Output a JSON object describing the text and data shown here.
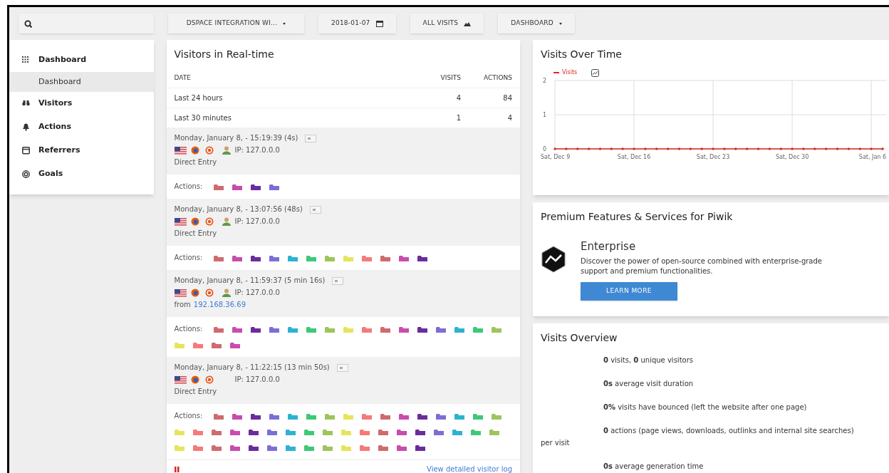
{
  "topbar": {
    "buttons": [
      {
        "label": "DSPACE INTEGRATION WI..."
      },
      {
        "label": "2018-01-07"
      },
      {
        "label": "ALL VISITS"
      },
      {
        "label": "DASHBOARD"
      }
    ]
  },
  "sidebar": {
    "items": [
      {
        "label": "Dashboard",
        "selected": false,
        "children": [
          {
            "label": "Dashboard",
            "selected": true
          }
        ]
      },
      {
        "label": "Visitors",
        "selected": false
      },
      {
        "label": "Actions",
        "selected": false
      },
      {
        "label": "Referrers",
        "selected": false
      },
      {
        "label": "Goals",
        "selected": false
      }
    ]
  },
  "realtime": {
    "title": "Visitors in Real-time",
    "columns": [
      "DATE",
      "VISITS",
      "ACTIONS"
    ],
    "rows": [
      [
        "Last 24 hours",
        "4",
        "84"
      ],
      [
        "Last 30 minutes",
        "1",
        "4"
      ]
    ],
    "visits": [
      {
        "time": "Monday, January 8, - 15:19:39 (4s)",
        "profile": true,
        "ip": "IP: 127.0.0.0",
        "referrer": "Direct Entry",
        "actions_label": "Actions:",
        "actions": [
          {
            "color": "#cf6b6e"
          },
          {
            "color": "#c94cae"
          },
          {
            "color": "#6b2c9c"
          },
          {
            "color": "#7b6fd6"
          }
        ]
      },
      {
        "time": "Monday, January 8, - 13:07:56 (48s)",
        "profile": true,
        "ip": "IP: 127.0.0.0",
        "referrer": "Direct Entry",
        "actions_label": "Actions:",
        "actions": [
          {
            "color": "#cf6b6e"
          },
          {
            "color": "#c94cae"
          },
          {
            "color": "#6b2c9c"
          },
          {
            "color": "#7b6fd6"
          },
          {
            "color": "#2db3cf"
          },
          {
            "color": "#3ec977"
          },
          {
            "color": "#9ec45c"
          },
          {
            "color": "#e6e45c"
          },
          {
            "color": "#f57a7a"
          },
          {
            "color": "#cf6b6e"
          },
          {
            "color": "#c94cae"
          },
          {
            "color": "#6b2c9c"
          }
        ]
      },
      {
        "time": "Monday, January 8, - 11:59:37 (5 min 16s)",
        "profile": true,
        "ip": "IP: 127.0.0.0",
        "referrer": "from",
        "referrer_link": "192.168.36.69",
        "actions_label": "Actions:",
        "actions": [
          {
            "color": "#cf6b6e"
          },
          {
            "color": "#c94cae"
          },
          {
            "color": "#6b2c9c"
          },
          {
            "color": "#7b6fd6"
          },
          {
            "color": "#2db3cf"
          },
          {
            "color": "#3ec977"
          },
          {
            "color": "#9ec45c"
          },
          {
            "color": "#e6e45c"
          },
          {
            "color": "#f57a7a"
          },
          {
            "color": "#cf6b6e"
          },
          {
            "color": "#c94cae"
          },
          {
            "color": "#6b2c9c"
          },
          {
            "color": "#7b6fd6"
          },
          {
            "color": "#2db3cf"
          },
          {
            "color": "#3ec977"
          },
          {
            "color": "#9ec45c"
          },
          {
            "color": "#e6e45c"
          },
          {
            "color": "#f57a7a"
          },
          {
            "color": "#cf6b6e"
          },
          {
            "color": "#c94cae"
          }
        ]
      },
      {
        "time": "Monday, January 8, - 11:22:15 (13 min 50s)",
        "profile": false,
        "ip": "IP: 127.0.0.0",
        "referrer": "Direct Entry",
        "actions_label": "Actions:",
        "actions": [
          {
            "color": "#cf6b6e"
          },
          {
            "color": "#c94cae"
          },
          {
            "color": "#6b2c9c"
          },
          {
            "color": "#7b6fd6"
          },
          {
            "color": "#2db3cf"
          },
          {
            "color": "#3ec977"
          },
          {
            "color": "#9ec45c"
          },
          {
            "color": "#e6e45c"
          },
          {
            "color": "#f57a7a"
          },
          {
            "color": "#cf6b6e"
          },
          {
            "color": "#c94cae"
          },
          {
            "color": "#6b2c9c"
          },
          {
            "color": "#7b6fd6"
          },
          {
            "color": "#2db3cf"
          },
          {
            "color": "#3ec977"
          },
          {
            "color": "#9ec45c"
          },
          {
            "color": "#e6e45c"
          },
          {
            "color": "#f57a7a"
          },
          {
            "color": "#cf6b6e"
          },
          {
            "color": "#c94cae"
          },
          {
            "color": "#6b2c9c"
          },
          {
            "color": "#7b6fd6"
          },
          {
            "color": "#2db3cf"
          },
          {
            "color": "#3ec977"
          },
          {
            "color": "#9ec45c"
          },
          {
            "color": "#e6e45c"
          },
          {
            "color": "#f57a7a"
          },
          {
            "color": "#cf6b6e"
          },
          {
            "color": "#c94cae"
          },
          {
            "color": "#6b2c9c"
          },
          {
            "color": "#7b6fd6"
          },
          {
            "color": "#2db3cf"
          },
          {
            "color": "#3ec977"
          },
          {
            "color": "#9ec45c"
          },
          {
            "color": "#e6e45c"
          },
          {
            "color": "#f57a7a"
          },
          {
            "color": "#cf6b6e"
          },
          {
            "color": "#c94cae"
          },
          {
            "color": "#6b2c9c"
          },
          {
            "color": "#7b6fd6"
          },
          {
            "color": "#2db3cf"
          },
          {
            "color": "#3ec977"
          },
          {
            "color": "#9ec45c"
          },
          {
            "color": "#e6e45c"
          },
          {
            "color": "#f57a7a"
          },
          {
            "color": "#cf6b6e"
          },
          {
            "color": "#c94cae"
          },
          {
            "color": "#6b2c9c"
          }
        ]
      }
    ],
    "footer_link": "View detailed visitor log"
  },
  "visits_over_time": {
    "title": "Visits Over Time",
    "chart_data": {
      "type": "line",
      "grid": true,
      "categories": [
        "Sat, Dec 9",
        null,
        null,
        null,
        null,
        null,
        null,
        "Sat, Dec 16",
        null,
        null,
        null,
        null,
        null,
        null,
        "Sat, Dec 23",
        null,
        null,
        null,
        null,
        null,
        null,
        "Sat, Dec 30",
        null,
        null,
        null,
        null,
        null,
        null,
        "Sat, Jan 6",
        null
      ],
      "series": [
        {
          "name": "Visits",
          "color": "#d4291f",
          "values": [
            0,
            0,
            0,
            0,
            0,
            0,
            0,
            0,
            0,
            0,
            0,
            0,
            0,
            0,
            0,
            0,
            0,
            0,
            0,
            0,
            0,
            0,
            0,
            0,
            0,
            0,
            0,
            0,
            0,
            0
          ]
        }
      ],
      "ylim": [
        0,
        2
      ],
      "yticks": [
        0,
        1,
        2
      ]
    }
  },
  "premium": {
    "title": "Premium Features & Services for Piwik",
    "heading": "Enterprise",
    "text": "Discover the power of open-source combined with enterprise-grade support and premium functionalities.",
    "button": "LEARN MORE"
  },
  "overview": {
    "title": "Visits Overview",
    "lines": [
      "**0** visits, **0** unique visitors",
      "**0s** average visit duration",
      "**0%** visits have bounced (left the website after one page)",
      "**0** actions (page views, downloads, outlinks and internal site searches) per visit",
      "**0s** average generation time"
    ]
  }
}
